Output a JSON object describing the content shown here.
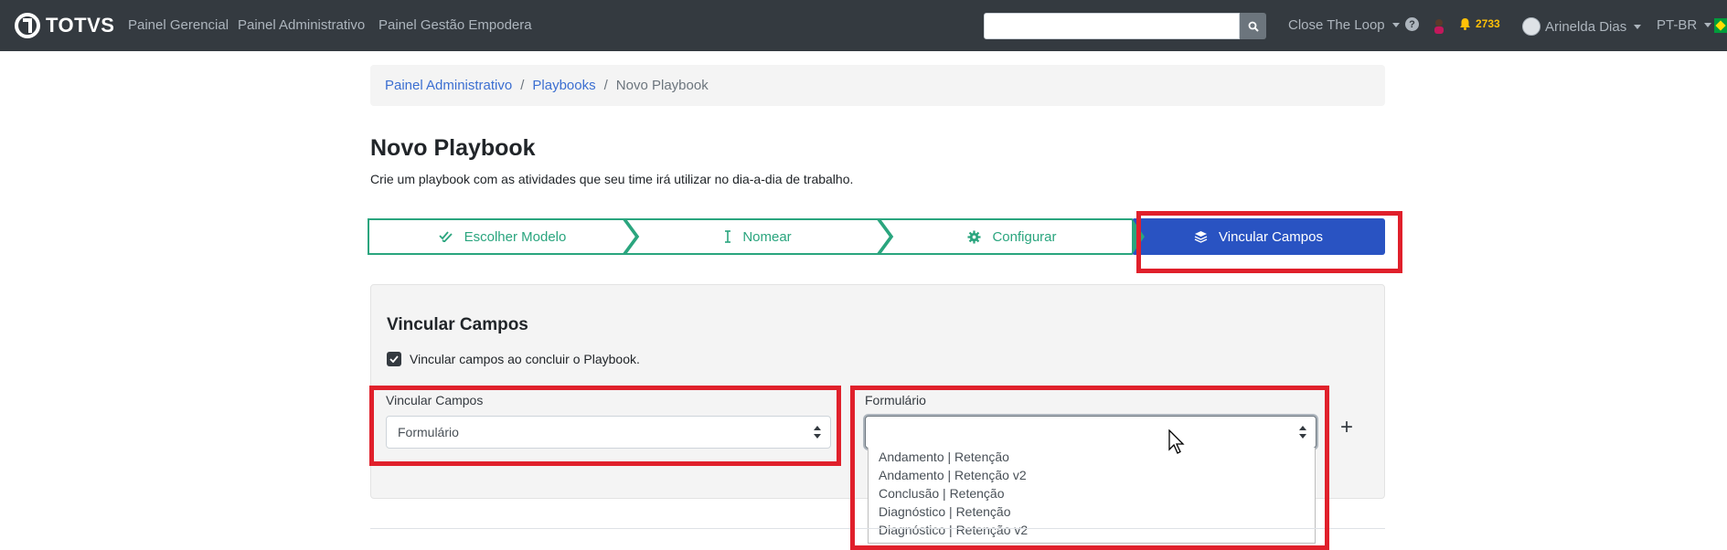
{
  "navbar": {
    "brand": "TOTVS",
    "links": [
      "Painel Gerencial",
      "Painel Administrativo",
      "Painel Gestão Empodera"
    ],
    "search_placeholder": "",
    "close_the_loop": "Close The Loop",
    "notification_count": "2733",
    "user_name": "Arinelda Dias",
    "language": "PT-BR"
  },
  "breadcrumb": {
    "items": [
      "Painel Administrativo",
      "Playbooks"
    ],
    "current": "Novo Playbook"
  },
  "header": {
    "title": "Novo Playbook",
    "subtitle": "Crie um playbook com as atividades que seu time irá utilizar no dia-a-dia de trabalho."
  },
  "stepper": {
    "steps": [
      "Escolher Modelo",
      "Nomear",
      "Configurar",
      "Vincular Campos"
    ],
    "active_index": 3,
    "done_color": "#2aa57e",
    "active_color": "#2953c2"
  },
  "card": {
    "title": "Vincular Campos",
    "checkbox_label": "Vincular campos ao concluir o Playbook.",
    "checkbox_checked": true,
    "field1_label": "Vincular Campos",
    "field1_value": "Formulário",
    "field2_label": "Formulário",
    "field2_value": "",
    "add_label": "+"
  },
  "dropdown": {
    "options": [
      "Andamento | Retenção",
      "Andamento | Retenção v2",
      "Conclusão | Retenção",
      "Diagnóstico | Retenção",
      "Diagnóstico | Retenção v2"
    ]
  },
  "colors": {
    "navbar": "#343a40",
    "highlight": "#e0202b",
    "link": "#3c6fd1"
  }
}
